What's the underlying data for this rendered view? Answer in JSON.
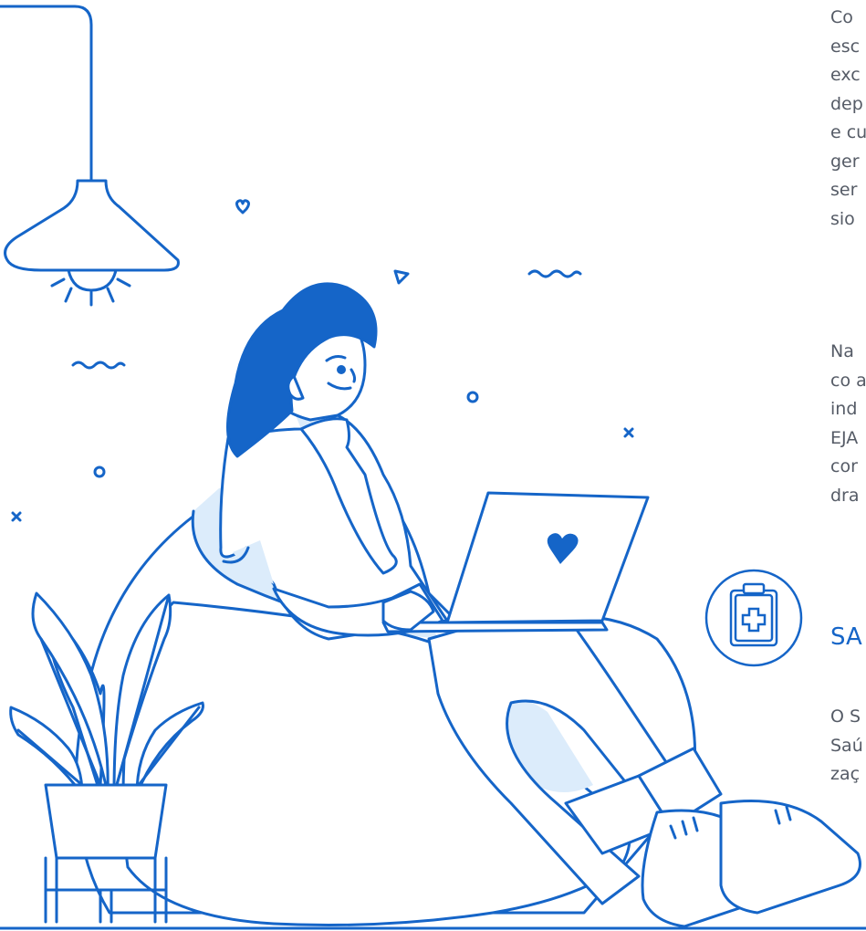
{
  "text_fragments": {
    "paragraph_1": [
      "Co",
      "esc",
      "exc",
      "dep",
      "e cu",
      "ger",
      "ser",
      "sio"
    ],
    "paragraph_2": [
      "Na",
      "co a",
      "ind",
      "EJA",
      "cor",
      "dra"
    ],
    "section_title": "SA",
    "paragraph_3": [
      "O S",
      "Saú",
      "zaç"
    ]
  },
  "icons": {
    "badge": "clipboard-medical-icon",
    "laptop_logo": "heart-icon"
  },
  "colors": {
    "primary_blue": "#1565c8",
    "light_blue_fill": "#dcecfb",
    "text_gray": "#555b66",
    "background": "#ffffff"
  }
}
